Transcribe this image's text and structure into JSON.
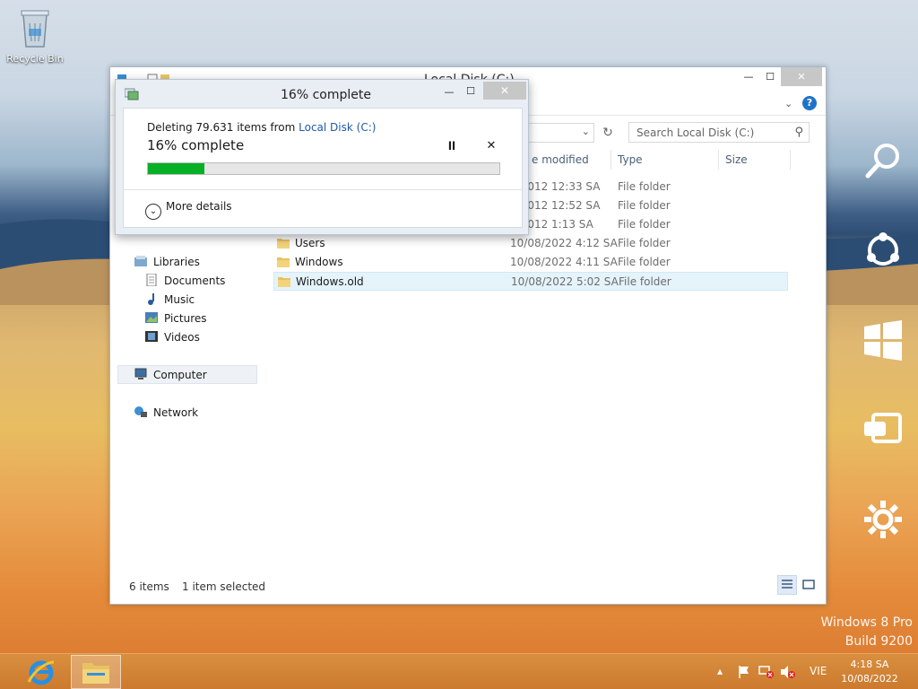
{
  "desktop": {
    "recycle_bin_label": "Recycle Bin",
    "watermark_line1": "Windows 8 Pro",
    "watermark_line2": "Build 9200"
  },
  "explorer": {
    "title": "Local Disk (C:)",
    "search_placeholder": "Search Local Disk (C:)",
    "columns": {
      "date": "e modified",
      "type": "Type",
      "size": "Size"
    },
    "files": [
      {
        "name": "",
        "date": "7/2012 12:33 SA",
        "type": "File folder"
      },
      {
        "name": "",
        "date": "7/2012 12:52 SA",
        "type": "File folder"
      },
      {
        "name": "",
        "date": "7/2012 1:13 SA",
        "type": "File folder"
      },
      {
        "name": "Users",
        "date": "10/08/2022 4:12 SA",
        "type": "File folder"
      },
      {
        "name": "Windows",
        "date": "10/08/2022 4:11 SA",
        "type": "File folder"
      },
      {
        "name": "Windows.old",
        "date": "10/08/2022 5:02 SA",
        "type": "File folder"
      }
    ],
    "nav": {
      "libraries": "Libraries",
      "documents": "Documents",
      "music": "Music",
      "pictures": "Pictures",
      "videos": "Videos",
      "computer": "Computer",
      "network": "Network"
    },
    "status": {
      "items": "6 items",
      "selected": "1 item selected"
    }
  },
  "dialog": {
    "title": "16% complete",
    "deleting_prefix": "Deleting 79.631 items from ",
    "location_link": "Local Disk (C:)",
    "percent_text": "16% complete",
    "progress_fraction": 0.16,
    "more_details": "More details"
  },
  "taskbar": {
    "language": "VIE",
    "time": "4:18 SA",
    "date": "10/08/2022"
  },
  "colors": {
    "progress_fill": "#06b025",
    "link": "#1e5aa8",
    "taskbar": "#cc7a2e"
  }
}
